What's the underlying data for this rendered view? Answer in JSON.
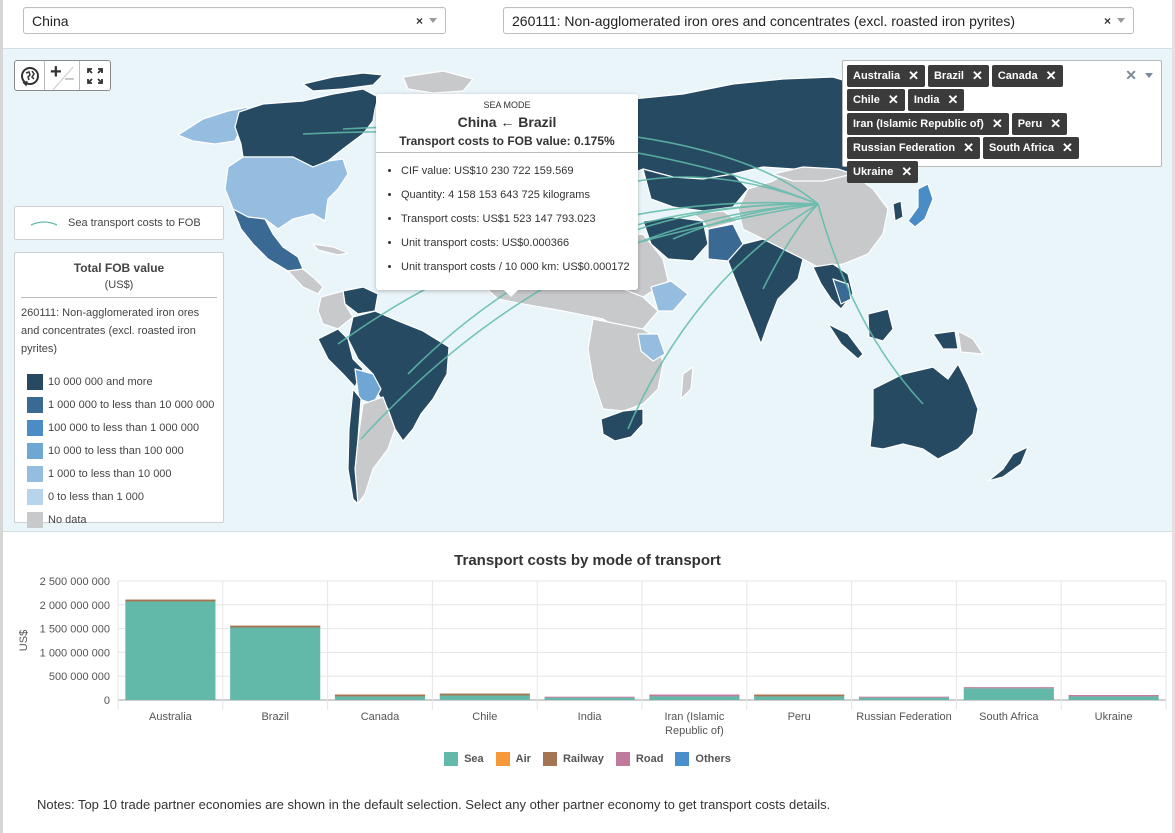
{
  "reporter_select": {
    "value": "China"
  },
  "product_select": {
    "value": "260111: Non-agglomerated iron ores and concentrates (excl. roasted iron pyrites)"
  },
  "map": {
    "controls": {
      "reset_icon": "globe-reset-icon",
      "zoom_in": "+",
      "zoom_out": "–",
      "fullscreen_icon": "fullscreen-icon"
    },
    "line_legend": {
      "label": "Sea transport costs to FOB",
      "color": "#5fbcaa"
    },
    "fob_legend": {
      "title": "Total FOB value",
      "unit": "(US$)",
      "product": "260111: Non-agglomerated iron ores and concentrates (excl. roasted iron pyrites)",
      "items": [
        {
          "label": "10 000 000 and more",
          "color": "#274a63"
        },
        {
          "label": "1 000 000 to less than 10 000 000",
          "color": "#3a6a93"
        },
        {
          "label": "100 000 to less than 1 000 000",
          "color": "#4a8dc6"
        },
        {
          "label": "10 000 to less than 100 000",
          "color": "#6fa6d4"
        },
        {
          "label": "1 000 to less than 10 000",
          "color": "#95bde0"
        },
        {
          "label": "0 to less than 1 000",
          "color": "#b7d4ec"
        },
        {
          "label": "No data",
          "color": "#c8c9cb"
        }
      ]
    },
    "tooltip": {
      "mode": "SEA MODE",
      "route": "China ← Brazil",
      "ratio": "Transport costs to FOB value: 0.175%",
      "items": [
        "CIF value: US$10 230 722 159.569",
        "Quantity: 4 158 153 643 725 kilograms",
        "Transport costs: US$1 523 147 793.023",
        "Unit transport costs: US$0.000366",
        "Unit transport costs / 10 000 km: US$0.000172"
      ]
    },
    "partners": {
      "tags": [
        "Australia",
        "Brazil",
        "Canada",
        "Chile",
        "India",
        "Iran (Islamic Republic of)",
        "Peru",
        "Russian Federation",
        "South Africa",
        "Ukraine"
      ],
      "remove_glyph": "✕",
      "clear_glyph": "✕"
    }
  },
  "chart_data": {
    "type": "bar",
    "stacked": true,
    "title": "Transport costs by mode of transport",
    "xlabel": "",
    "ylabel": "US$",
    "ylim": [
      0,
      2500000000
    ],
    "yticks": [
      0,
      500000000,
      1000000000,
      1500000000,
      2000000000,
      2500000000
    ],
    "ytick_labels": [
      "0",
      "500 000 000",
      "1 000 000 000",
      "1 500 000 000",
      "2 000 000 000",
      "2 500 000 000"
    ],
    "grid": true,
    "legend_position": "bottom",
    "categories": [
      "Australia",
      "Brazil",
      "Canada",
      "Chile",
      "India",
      "Iran (Islamic Republic of)",
      "Peru",
      "Russian Federation",
      "South Africa",
      "Ukraine"
    ],
    "category_labels": [
      [
        "Australia"
      ],
      [
        "Brazil"
      ],
      [
        "Canada"
      ],
      [
        "Chile"
      ],
      [
        "India"
      ],
      [
        "Iran (Islamic",
        "Republic of)"
      ],
      [
        "Peru"
      ],
      [
        "Russian Federation"
      ],
      [
        "South Africa"
      ],
      [
        "Ukraine"
      ]
    ],
    "series": [
      {
        "name": "Sea",
        "color": "#62b9a9",
        "values": [
          2070000000,
          1523000000,
          75000000,
          95000000,
          50000000,
          75000000,
          75000000,
          50000000,
          245000000,
          75000000
        ]
      },
      {
        "name": "Air",
        "color": "#f7983a",
        "values": [
          0,
          0,
          0,
          0,
          0,
          0,
          0,
          0,
          0,
          0
        ]
      },
      {
        "name": "Railway",
        "color": "#a37552",
        "values": [
          40000000,
          40000000,
          40000000,
          40000000,
          0,
          0,
          40000000,
          0,
          0,
          0
        ]
      },
      {
        "name": "Road",
        "color": "#c07a9c",
        "values": [
          0,
          0,
          0,
          0,
          20000000,
          40000000,
          0,
          20000000,
          25000000,
          30000000
        ]
      },
      {
        "name": "Others",
        "color": "#4a8fcb",
        "values": [
          0,
          0,
          0,
          0,
          0,
          0,
          0,
          0,
          0,
          0
        ]
      }
    ]
  },
  "notes": "Notes: Top 10 trade partner economies are shown in the default selection. Select any other partner economy to get transport costs details."
}
